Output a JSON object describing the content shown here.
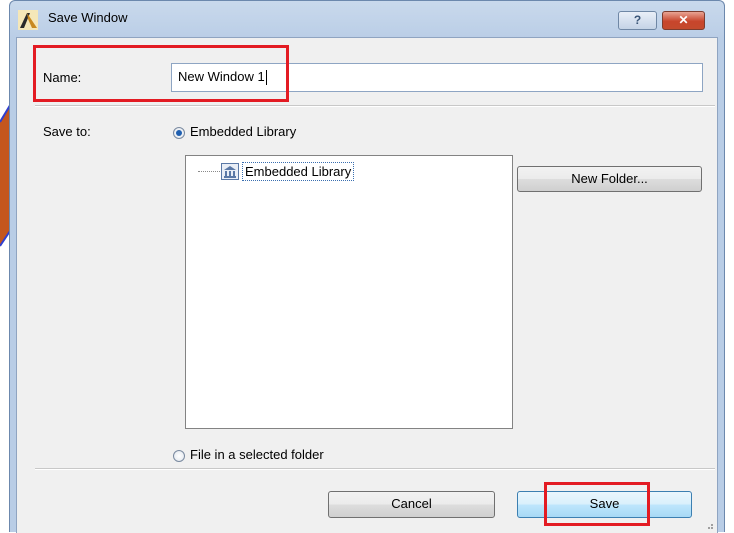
{
  "window": {
    "title": "Save Window",
    "help_glyph": "?",
    "close_glyph": "✕"
  },
  "name_field": {
    "label": "Name:",
    "value": "New Window 1"
  },
  "save_to": {
    "label": "Save to:",
    "options": [
      {
        "label": "Embedded Library",
        "selected": true
      },
      {
        "label": "File in a selected folder",
        "selected": false
      }
    ]
  },
  "tree": {
    "items": [
      {
        "label": "Embedded Library",
        "icon": "library-icon"
      }
    ]
  },
  "buttons": {
    "new_folder": "New Folder...",
    "cancel": "Cancel",
    "save": "Save"
  },
  "colors": {
    "highlight": "#e31b23",
    "accent": "#1f5fb0"
  }
}
